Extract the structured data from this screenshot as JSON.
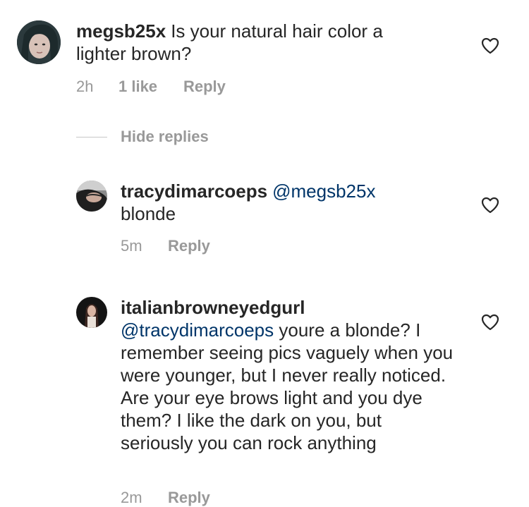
{
  "comments": [
    {
      "username": "megsb25x",
      "mention": "",
      "text": "Is your natural hair color a lighter brown?",
      "time": "2h",
      "likes": "1 like",
      "reply_label": "Reply"
    },
    {
      "username": "tracydimarcoeps",
      "mention": "@megsb25x",
      "text": "blonde",
      "time": "5m",
      "likes": "",
      "reply_label": "Reply"
    },
    {
      "username": "italianbrowneyedgurl",
      "mention": "@tracydimarcoeps",
      "text": "youre a blonde? I remember seeing pics vaguely when you were younger,  but I never really noticed.  Are your eye brows light and you dye them? I like the dark on you,  but seriously you can rock anything",
      "time": "2m",
      "likes": "",
      "reply_label": "Reply"
    }
  ],
  "hide_replies_label": "Hide replies",
  "colors": {
    "text": "#262626",
    "meta": "#999999",
    "mention": "#003569",
    "divider": "#c7c7c7"
  },
  "icons": {
    "like": "heart-outline-icon"
  }
}
